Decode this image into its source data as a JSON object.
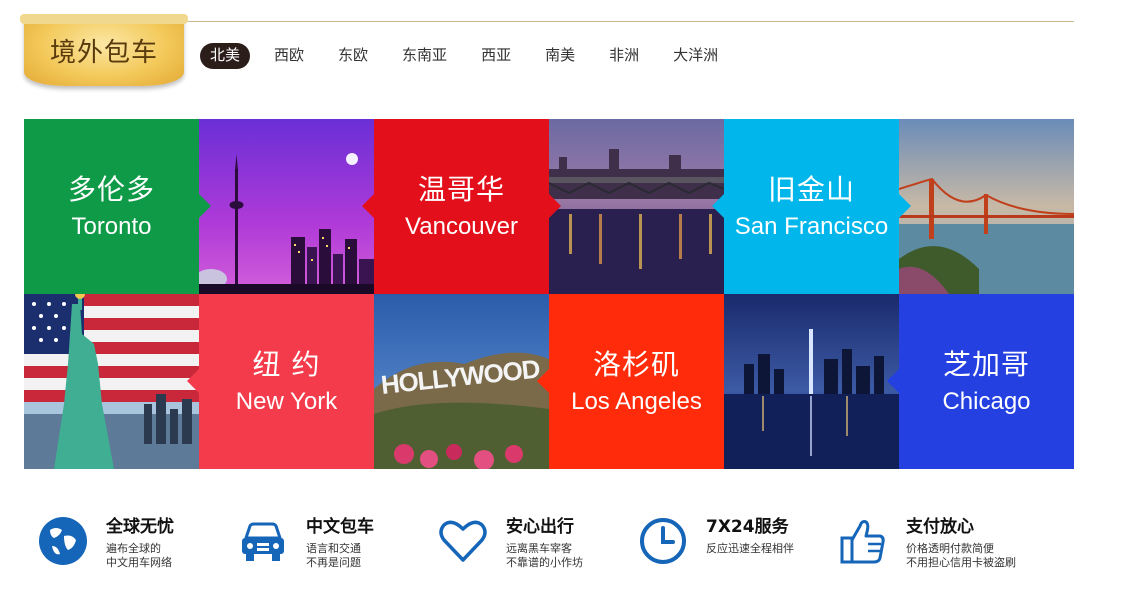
{
  "header": {
    "badge_title": "境外包车",
    "regions": [
      "北美",
      "西欧",
      "东欧",
      "东南亚",
      "西亚",
      "南美",
      "非洲",
      "大洋洲"
    ],
    "active_region": "北美"
  },
  "cities": [
    {
      "cn": "多伦多",
      "en": "Toronto",
      "color": "#0f9a47"
    },
    {
      "cn": "温哥华",
      "en": "Vancouver",
      "color": "#e3101c"
    },
    {
      "cn": "旧金山",
      "en": "San Francisco",
      "color": "#00b6ea"
    },
    {
      "cn": "纽 约",
      "en": "New York",
      "color": "#f43b4b"
    },
    {
      "cn": "洛杉矶",
      "en": "Los Angeles",
      "color": "#ff2b0a"
    },
    {
      "cn": "芝加哥",
      "en": "Chicago",
      "color": "#2540e0"
    }
  ],
  "photos": {
    "hollywood_sign": "HOLLYWOOD"
  },
  "features": [
    {
      "icon": "globe-icon",
      "title": "全球无忧",
      "line1": "遍布全球的",
      "line2": "中文用车网络"
    },
    {
      "icon": "car-icon",
      "title": "中文包车",
      "line1": "语言和交通",
      "line2": "不再是问题"
    },
    {
      "icon": "heart-icon",
      "title": "安心出行",
      "line1": "远离黑车宰客",
      "line2": "不靠谱的小作坊"
    },
    {
      "icon": "clock-icon",
      "title": "7X24服务",
      "line1": "反应迅速全程相伴",
      "line2": ""
    },
    {
      "icon": "thumbs-up-icon",
      "title": "支付放心",
      "line1": "价格透明付款简便",
      "line2": "不用担心信用卡被盗刷"
    }
  ],
  "colors": {
    "icon_blue": "#1565b8",
    "nav_active_bg": "#2b1d1a"
  }
}
